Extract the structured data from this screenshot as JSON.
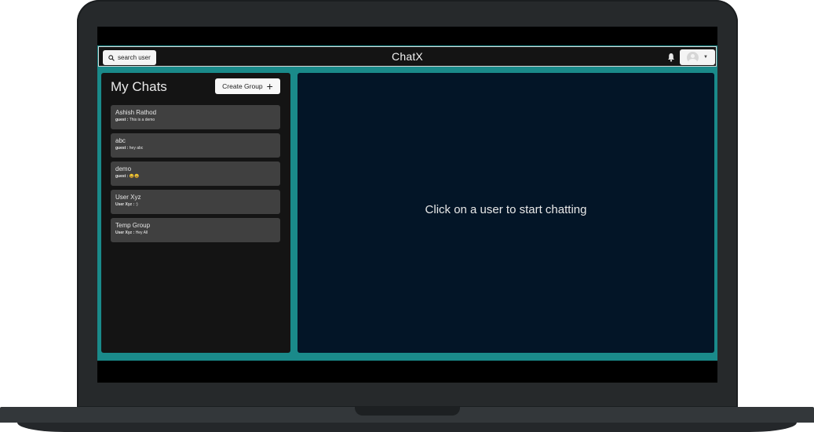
{
  "app": {
    "title": "ChatX",
    "search_label": "search user"
  },
  "chats": {
    "title": "My Chats",
    "create_group_label": "Create Group",
    "items": [
      {
        "name": "Ashish Rathod",
        "sender": "guest :",
        "message": "This is a demo"
      },
      {
        "name": "abc",
        "sender": "guest :",
        "message": "hey abc"
      },
      {
        "name": "demo",
        "sender": "guest :",
        "message": "😀😀"
      },
      {
        "name": "User Xyz",
        "sender": "User Xyz :",
        "message": ":)"
      },
      {
        "name": "Temp Group",
        "sender": "User Xyz :",
        "message": "Hey All"
      }
    ]
  },
  "chat_box": {
    "empty_text": "Click on a user to start chatting"
  },
  "icons": [
    "search-icon",
    "bell-icon",
    "avatar",
    "chevron-down-icon",
    "plus-icon"
  ],
  "colors": {
    "accent": "#1a8a8a",
    "panel": "#141414",
    "chat_item": "#404040",
    "chat_box": "#031527"
  }
}
